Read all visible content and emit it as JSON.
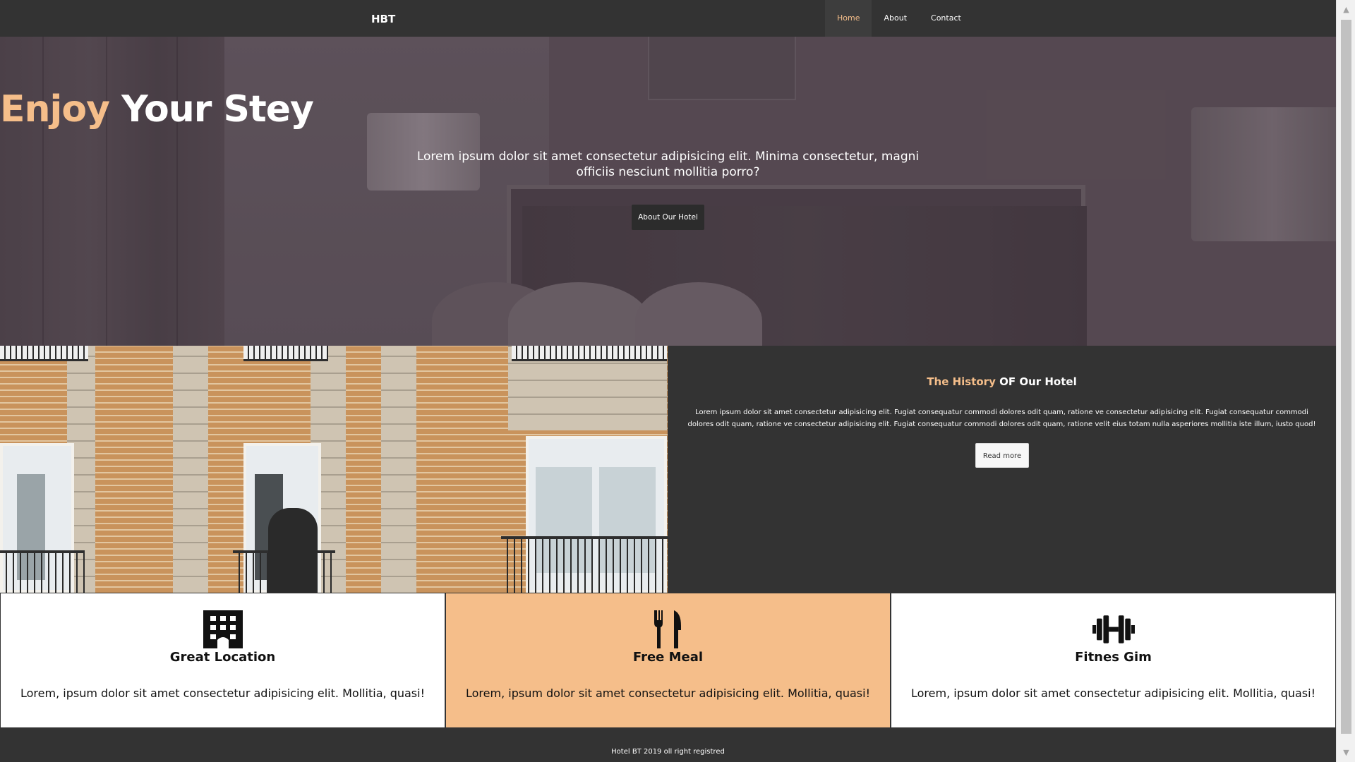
{
  "navbar": {
    "brand": "HBT",
    "items": [
      {
        "label": "Home",
        "active": true
      },
      {
        "label": "About",
        "active": false
      },
      {
        "label": "Contact",
        "active": false
      }
    ]
  },
  "hero": {
    "title_accent": "Enjoy",
    "title_rest": " Your Stey",
    "text": "Lorem ipsum dolor sit amet consectetur adipisicing elit. Minima consectetur, magni officiis nesciunt mollitia porro?",
    "button_label": "About Our Hotel"
  },
  "history": {
    "title_accent": "The History",
    "title_rest": " OF Our Hotel",
    "text": "Lorem ipsum dolor sit amet consectetur adipisicing elit. Fugiat consequatur commodi dolores odit quam, ratione ve consectetur adipisicing elit. Fugiat consequatur commodi dolores odit quam, ratione ve consectetur adipisicing elit. Fugiat consequatur commodi dolores odit quam, ratione velit eius totam nulla asperiores mollitia iste illum, iusto quod!",
    "button_label": "Read more"
  },
  "features": [
    {
      "icon": "building-icon",
      "title": "Great Location",
      "text": "Lorem, ipsum dolor sit amet consectetur adipisicing elit. Mollitia, quasi!"
    },
    {
      "icon": "utensils-icon",
      "title": "Free Meal",
      "text": "Lorem, ipsum dolor sit amet consectetur adipisicing elit. Mollitia, quasi!"
    },
    {
      "icon": "dumbbell-icon",
      "title": "Fitnes Gim",
      "text": "Lorem, ipsum dolor sit amet consectetur adipisicing elit. Mollitia, quasi!"
    }
  ],
  "footer": {
    "text": "Hotel BT 2019 oll right registred"
  },
  "colors": {
    "accent": "#f5be8a",
    "dark": "#333333",
    "white": "#ffffff"
  }
}
